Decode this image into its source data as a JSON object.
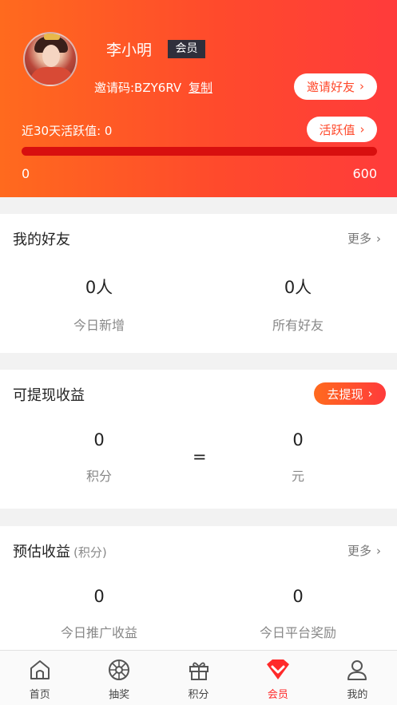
{
  "profile": {
    "name": "李小明",
    "badge": "会员",
    "invite_code_text": "邀请码:BZY6RV",
    "copy_label": "复制",
    "invite_button": "邀请好友",
    "activity_text": "近30天活跃值: 0",
    "activity_button": "活跃值",
    "progress_min": "0",
    "progress_max": "600",
    "progress_value": 0
  },
  "friends": {
    "title": "我的好友",
    "more": "更多",
    "today_value": "0人",
    "today_label": "今日新增",
    "all_value": "0人",
    "all_label": "所有好友"
  },
  "withdraw": {
    "title": "可提现收益",
    "button": "去提现",
    "points_value": "0",
    "points_label": "积分",
    "equals": "=",
    "yuan_value": "0",
    "yuan_label": "元"
  },
  "estimate": {
    "title": "预估收益",
    "title_sub": "(积分)",
    "more": "更多",
    "promo_value": "0",
    "promo_label": "今日推广收益",
    "platform_value": "0",
    "platform_label": "今日平台奖励"
  },
  "tabs": [
    {
      "label": "首页",
      "icon": "home-icon"
    },
    {
      "label": "抽奖",
      "icon": "wheel-icon"
    },
    {
      "label": "积分",
      "icon": "gift-icon"
    },
    {
      "label": "会员",
      "icon": "vip-icon"
    },
    {
      "label": "我的",
      "icon": "user-icon"
    }
  ],
  "colors": {
    "accent": "#ff4a2c",
    "active_tab": "#ff2a2a",
    "progress_track": "#d80f0f"
  }
}
